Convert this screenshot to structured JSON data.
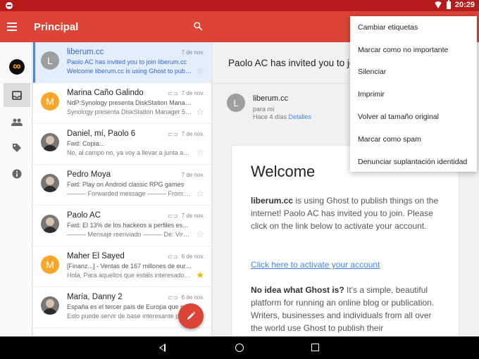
{
  "status_bar": {
    "time": "20:29"
  },
  "app_bar": {
    "title": "Principal"
  },
  "emails": [
    {
      "avatar_letter": "L",
      "avatar_color": "#9e9e9e",
      "sender": "liberum.cc",
      "date": "7 de nov.",
      "subject": "Paolo AC has invited you to join liberum.cc",
      "snippet": "Welcome liberum.cc is using Ghost to publish things on",
      "starred": false,
      "attachment": false,
      "selected": true,
      "photo": false
    },
    {
      "avatar_letter": "M",
      "avatar_color": "#f6a623",
      "sender": "Marina Caño Galindo",
      "date": "7 de nov.",
      "subject": "NdP:Synology presenta DiskStation Manager 5.1",
      "snippet": "Synology presenta DiskStation Manager 5.1 con",
      "starred": false,
      "attachment": true,
      "selected": false,
      "photo": false
    },
    {
      "avatar_letter": "",
      "avatar_color": "#777777",
      "sender": "Daniel, mí, Paolo  6",
      "date": "7 de nov.",
      "subject": "Fwd: Copia...",
      "snippet": "No, al campo no, ya voy a llevar a junta administrativa",
      "starred": false,
      "attachment": true,
      "selected": false,
      "photo": true
    },
    {
      "avatar_letter": "",
      "avatar_color": "#777777",
      "sender": "Pedro Moya",
      "date": "7 de nov.",
      "subject": "Fwd: Play on Android classic RPG games",
      "snippet": "——— Forwarded message ——— From: Pedro",
      "starred": false,
      "attachment": false,
      "selected": false,
      "photo": true
    },
    {
      "avatar_letter": "",
      "avatar_color": "#777777",
      "sender": "Paolo AC",
      "date": "7 de nov.",
      "subject": "Fwd: El 13% de los hackeos a perfiles españoles",
      "snippet": "——— Mensaje reenviado ——— De: Virginia",
      "starred": false,
      "attachment": true,
      "selected": false,
      "photo": true
    },
    {
      "avatar_letter": "M",
      "avatar_color": "#f6a623",
      "sender": "Maher El Sayed",
      "date": "6 de nov.",
      "subject": "[Finanz...] - Ventas de 167 millones de euros",
      "snippet": "Hola, Para aquellos que estáis interesados en",
      "starred": true,
      "attachment": true,
      "selected": false,
      "photo": false
    },
    {
      "avatar_letter": "",
      "avatar_color": "#777777",
      "sender": "María, Danny  2",
      "date": "6 de nov.",
      "subject": "España es el tercer país de Europa que más",
      "snippet": "Esto puede servir de base interesante para",
      "starred": false,
      "attachment": true,
      "selected": false,
      "photo": true
    }
  ],
  "message": {
    "subject": "Paolo AC has invited you to join liberum.cc",
    "from_letter": "L",
    "from_name": "liberum.cc",
    "to": "para mí",
    "time": "Hace 4 días",
    "details": "Detalles",
    "heading": "Welcome",
    "p1_bold": "liberum.cc",
    "p1_rest": " is using Ghost to publish things on the internet! Paolo AC has invited you to join. Please click on the link below to activate your account.",
    "link": "Click here to activate your account",
    "p2_bold": "No idea what Ghost is?",
    "p2_rest": " It's a simple, beautiful platform for running an online blog or publication. Writers, businesses and individuals from all over the world use Ghost to publish their"
  },
  "overflow_menu": [
    "Cambiar etiquetas",
    "Marcar como no importante",
    "Silenciar",
    "Imprimir",
    "Volver al tamaño original",
    "Marcar como spam",
    "Denunciar suplantación identidad"
  ],
  "icons": [
    "menu-icon",
    "search-icon",
    "inbox-icon",
    "people-icon",
    "label-icon",
    "info-icon",
    "pencil-icon",
    "star-icon",
    "attachment-icon",
    "wifi-icon",
    "battery-icon",
    "back-icon",
    "home-icon",
    "recents-icon"
  ],
  "colors": {
    "primary": "#db4437",
    "status_bar": "#b71c1c",
    "accent_blue": "#4285f4",
    "star_yellow": "#f4b400"
  }
}
